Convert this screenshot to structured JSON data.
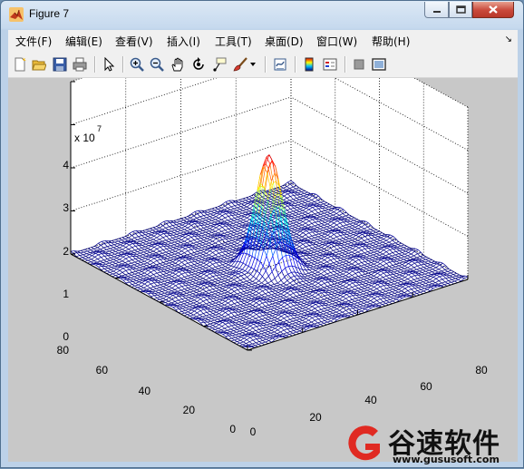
{
  "window": {
    "title": "Figure 7"
  },
  "menu": {
    "items": [
      {
        "label": "文件(F)"
      },
      {
        "label": "编辑(E)"
      },
      {
        "label": "查看(V)"
      },
      {
        "label": "插入(I)"
      },
      {
        "label": "工具(T)"
      },
      {
        "label": "桌面(D)"
      },
      {
        "label": "窗口(W)"
      },
      {
        "label": "帮助(H)"
      }
    ],
    "dock_glyph": "↘"
  },
  "toolbar": {
    "icons": [
      "new-figure-icon",
      "open-file-icon",
      "save-icon",
      "print-icon",
      "edit-plot-arrow-icon",
      "zoom-in-icon",
      "zoom-out-icon",
      "pan-hand-icon",
      "rotate-3d-icon",
      "data-cursor-icon",
      "brush-icon",
      "brush-dropdown-icon",
      "link-plot-icon",
      "colorbar-icon",
      "legend-icon",
      "hide-plot-tools-icon",
      "show-plot-tools-icon"
    ]
  },
  "plot": {
    "colormap": "jet",
    "z_exponent_label": "x 10",
    "z_exponent": "7",
    "z_ticks": [
      "4",
      "3",
      "2",
      "1",
      "0"
    ],
    "y_ticks": [
      "80",
      "60",
      "40",
      "20",
      "0"
    ],
    "x_ticks": [
      "0",
      "20",
      "40",
      "60",
      "80"
    ],
    "grid": true,
    "view": "3-D mesh"
  },
  "chart_data": {
    "type": "surface",
    "title": "",
    "xlabel": "",
    "ylabel": "",
    "zlabel": "",
    "xlim": [
      0,
      80
    ],
    "ylim": [
      0,
      80
    ],
    "zlim": [
      0,
      40000000
    ],
    "z_scale_text": "x 10^7",
    "grid": true,
    "series": [
      {
        "peak_x": 40,
        "peak_y": 40,
        "peak_z": 28000000,
        "shape": "twin-peak central mound",
        "base_z": 0
      }
    ]
  },
  "watermark": {
    "brand": "谷速软件",
    "url": "www.gususoft.com"
  }
}
